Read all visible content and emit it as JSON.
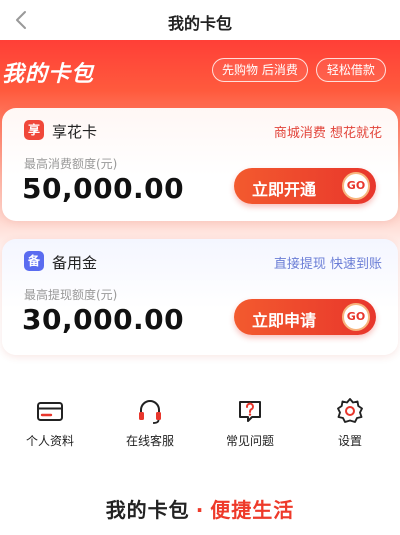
{
  "header": {
    "title": "我的卡包"
  },
  "hero": {
    "title": "我的卡包",
    "tags": [
      "先购物 后消费",
      "轻松借款"
    ]
  },
  "cards": [
    {
      "logo_char": "享",
      "name": "享花卡",
      "slogan": "商城消费 想花就花",
      "amount_label": "最高消费额度(元)",
      "amount": "50,000.00",
      "button_label": "立即开通",
      "go_label": "GO"
    },
    {
      "logo_char": "备",
      "name": "备用金",
      "slogan": "直接提现 快速到账",
      "amount_label": "最高提现额度(元)",
      "amount": "30,000.00",
      "button_label": "立即申请",
      "go_label": "GO"
    }
  ],
  "menu": [
    {
      "label": "个人资料",
      "icon": "card-icon"
    },
    {
      "label": "在线客服",
      "icon": "headset-icon"
    },
    {
      "label": "常见问题",
      "icon": "question-icon"
    },
    {
      "label": "设置",
      "icon": "gear-icon"
    }
  ],
  "footer": {
    "left": "我的卡包",
    "separator": "·",
    "right": "便捷生活"
  },
  "colors": {
    "accent": "#e8362c",
    "hero_red": "#ff3f37",
    "blue_logo": "#5a6cf0"
  }
}
